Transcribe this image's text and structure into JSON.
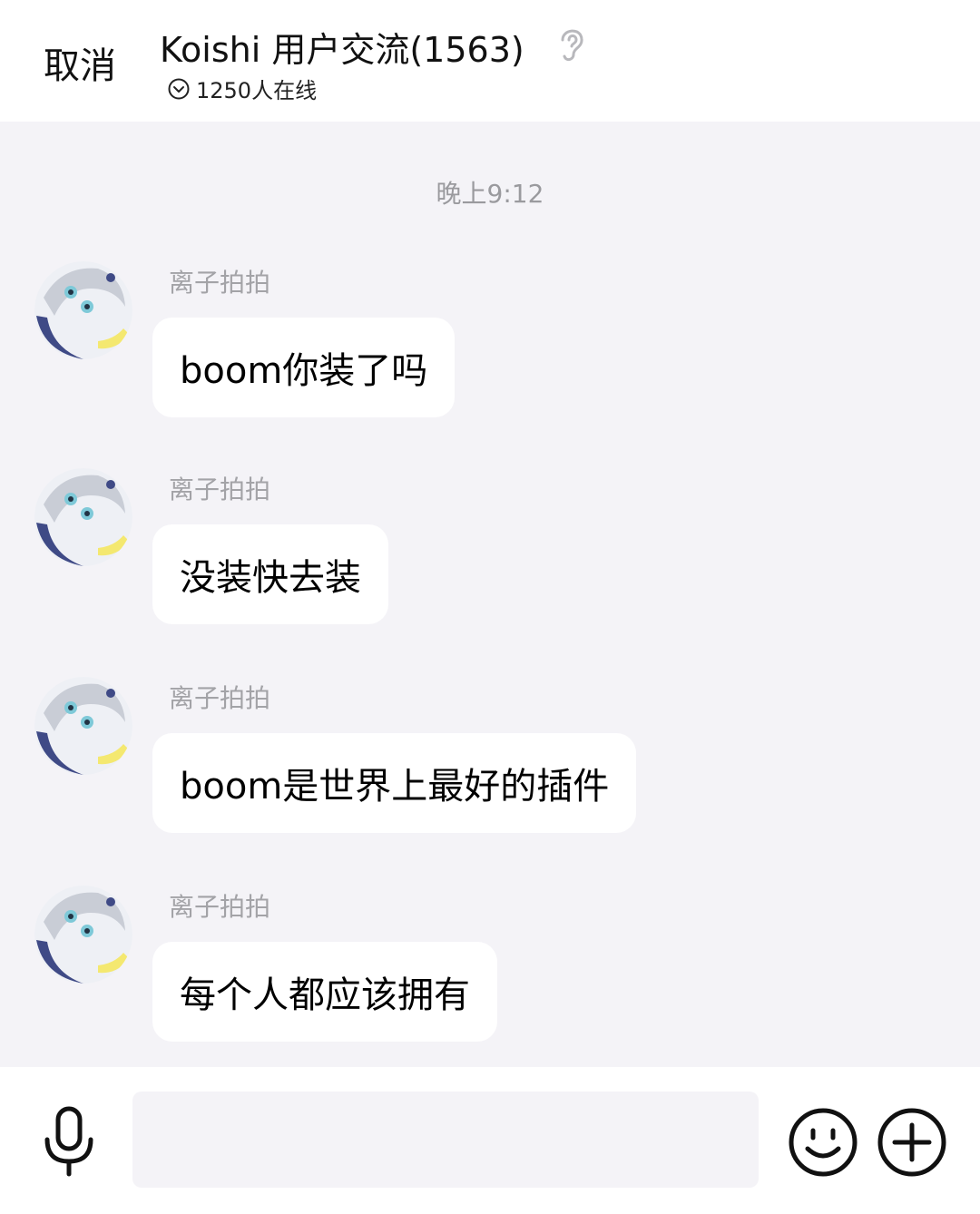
{
  "header": {
    "cancel_label": "取消",
    "title": "Koishi 用户交流(1563)",
    "online_text": "1250人在线",
    "icons": [
      "ear-icon",
      "chevron-down-icon"
    ]
  },
  "chat": {
    "timestamp": "晚上9:12",
    "messages": [
      {
        "sender": "离子拍拍",
        "text": "boom你装了吗"
      },
      {
        "sender": "离子拍拍",
        "text": "没装快去装"
      },
      {
        "sender": "离子拍拍",
        "text": "boom是世界上最好的插件"
      },
      {
        "sender": "离子拍拍",
        "text": "每个人都应该拥有"
      }
    ]
  },
  "input_bar": {
    "value": "",
    "icons": [
      "microphone-icon",
      "emoji-icon",
      "plus-icon"
    ]
  },
  "colors": {
    "background": "#f4f3f7",
    "bubble": "#ffffff",
    "secondary_text": "#a3a3a7"
  }
}
